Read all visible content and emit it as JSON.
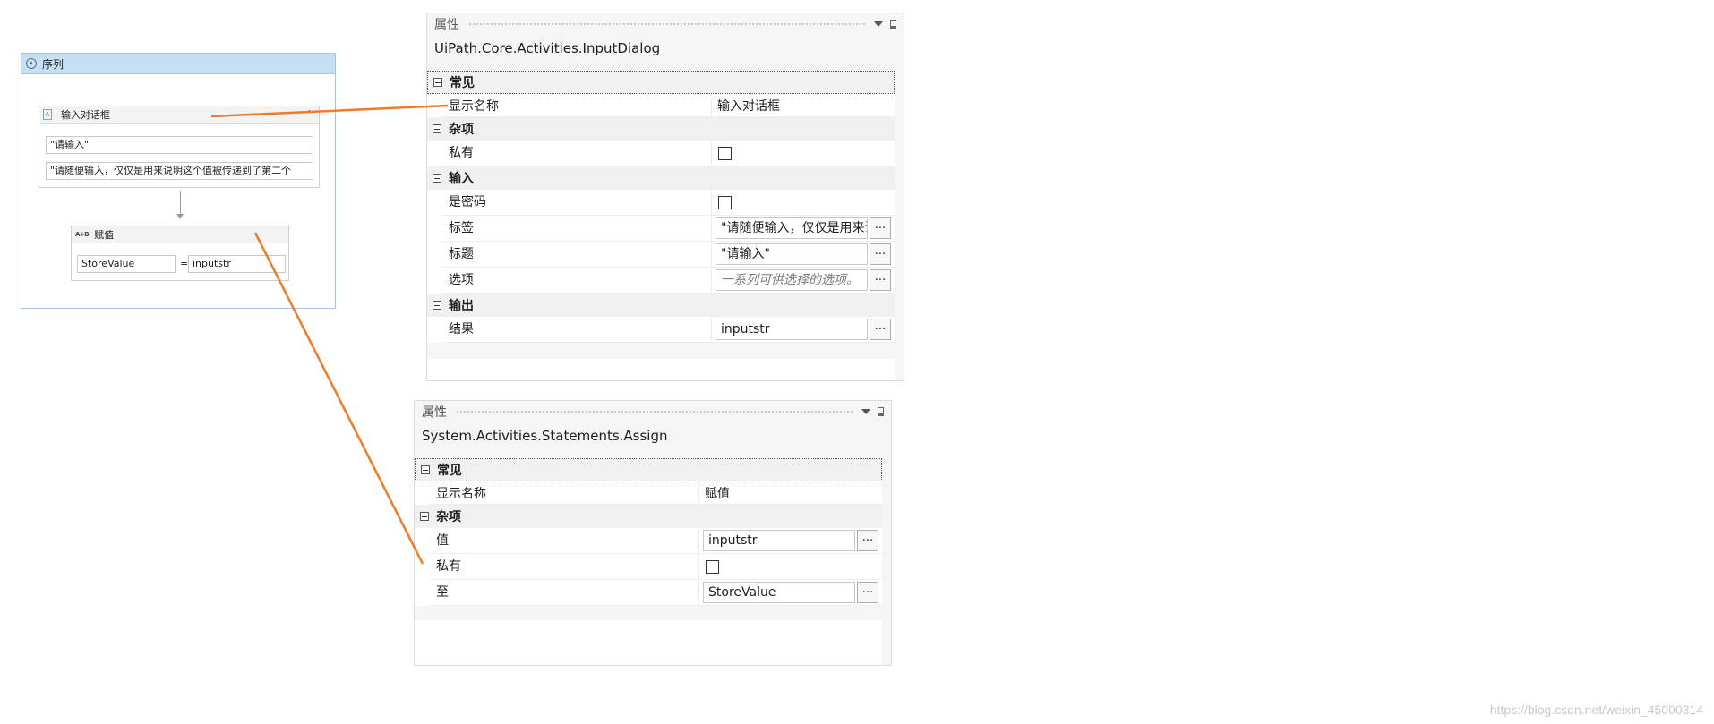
{
  "sequence": {
    "title": "序列",
    "input_dialog": {
      "title": "输入对话框",
      "title_field": "\"请输入\"",
      "label_field": "\"请随便输入，仅仅是用来说明这个值被传递到了第二个"
    },
    "assign": {
      "icon_text": "A+B",
      "title": "赋值",
      "to_field": "StoreValue",
      "equals": "=",
      "value_field": "inputstr"
    }
  },
  "panel1": {
    "title": "属性",
    "type_name": "UiPath.Core.Activities.InputDialog",
    "sections": {
      "common": "常见",
      "misc": "杂项",
      "input": "输入",
      "output": "输出"
    },
    "props": {
      "display_name_label": "显示名称",
      "display_name_value": "输入对话框",
      "private_label": "私有",
      "is_password_label": "是密码",
      "label_label": "标签",
      "label_value": "\"请随便输入，仅仅是用来说明这个值被传递到了第二个",
      "title_label": "标题",
      "title_value": "\"请输入\"",
      "options_label": "选项",
      "options_placeholder": "一系列可供选择的选项。",
      "result_label": "结果",
      "result_value": "inputstr"
    },
    "ellipsis": "..."
  },
  "panel2": {
    "title": "属性",
    "type_name": "System.Activities.Statements.Assign",
    "sections": {
      "common": "常见",
      "misc": "杂项"
    },
    "props": {
      "display_name_label": "显示名称",
      "display_name_value": "赋值",
      "value_label": "值",
      "value_value": "inputstr",
      "private_label": "私有",
      "to_label": "至",
      "to_value": "StoreValue"
    },
    "ellipsis": "..."
  },
  "watermark": "https://blog.csdn.net/weixin_45000314",
  "colors": {
    "annotation_line": "#f07c2a",
    "sequence_header": "#c7dff4"
  }
}
